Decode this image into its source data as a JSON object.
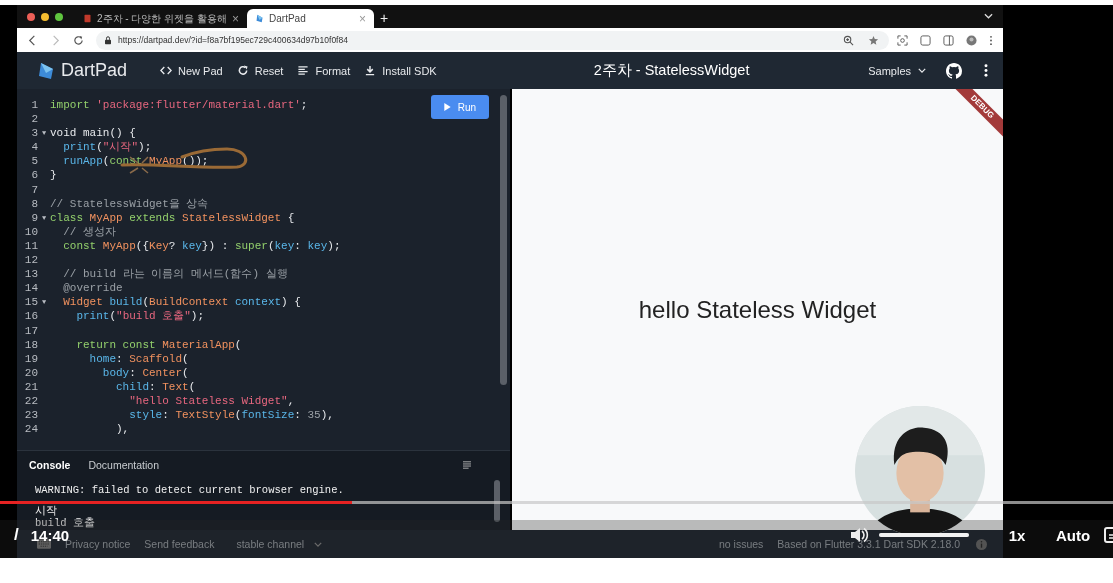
{
  "browser": {
    "tabs": [
      {
        "title": "2주차 - 다양한 위젯을 활용해",
        "selected": false,
        "close": "×"
      },
      {
        "title": "DartPad",
        "selected": true,
        "close": "×"
      }
    ],
    "new_tab": "+",
    "url": "https://dartpad.dev/?id=f8a7bf195ec729c400634d97b10f0f84"
  },
  "dartpad": {
    "brand": "DartPad",
    "actions": [
      "New Pad",
      "Reset",
      "Format",
      "Install SDK"
    ],
    "title": "2주차 - StatelessWidget",
    "samples": "Samples"
  },
  "editor": {
    "run": "Run",
    "lines": [
      {
        "n": "1",
        "tokens": [
          {
            "kind": "kw",
            "text": "import "
          },
          {
            "kind": "str",
            "text": "'package:flutter/material.dart'"
          },
          {
            "kind": "p",
            "text": ";"
          }
        ]
      },
      {
        "n": "2"
      },
      {
        "n": "3",
        "fold": "▼",
        "tokens": [
          {
            "kind": "p",
            "text": "void main() {"
          }
        ]
      },
      {
        "n": "4",
        "tokens": [
          {
            "kind": "fn",
            "text": "  print"
          },
          {
            "kind": "p",
            "text": "("
          },
          {
            "kind": "str",
            "text": "\"시작\""
          },
          {
            "kind": "p",
            "text": ");"
          }
        ]
      },
      {
        "n": "5",
        "tokens": [
          {
            "kind": "fn",
            "text": "  runApp"
          },
          {
            "kind": "p",
            "text": "("
          },
          {
            "kind": "kw",
            "text": "const "
          },
          {
            "kind": "type",
            "text": "MyApp"
          },
          {
            "kind": "p",
            "text": "());"
          }
        ]
      },
      {
        "n": "6",
        "tokens": [
          {
            "kind": "p",
            "text": "}"
          }
        ]
      },
      {
        "n": "7"
      },
      {
        "n": "8",
        "tokens": [
          {
            "kind": "com",
            "text": "// StatelessWidget을 상속"
          }
        ]
      },
      {
        "n": "9",
        "fold": "▼",
        "tokens": [
          {
            "kind": "kw",
            "text": "class "
          },
          {
            "kind": "type",
            "text": "MyApp "
          },
          {
            "kind": "kw",
            "text": "extends "
          },
          {
            "kind": "type",
            "text": "StatelessWidget "
          },
          {
            "kind": "p",
            "text": "{"
          }
        ]
      },
      {
        "n": "10",
        "tokens": [
          {
            "kind": "com",
            "text": "  // 생성자"
          }
        ]
      },
      {
        "n": "11",
        "tokens": [
          {
            "kind": "kw",
            "text": "  const "
          },
          {
            "kind": "type",
            "text": "MyApp"
          },
          {
            "kind": "p",
            "text": "({"
          },
          {
            "kind": "type",
            "text": "Key"
          },
          {
            "kind": "p",
            "text": "? "
          },
          {
            "kind": "fn",
            "text": "key"
          },
          {
            "kind": "p",
            "text": "}) : "
          },
          {
            "kind": "kw",
            "text": "super"
          },
          {
            "kind": "p",
            "text": "("
          },
          {
            "kind": "fn",
            "text": "key"
          },
          {
            "kind": "p",
            "text": ": "
          },
          {
            "kind": "fn",
            "text": "key"
          },
          {
            "kind": "p",
            "text": ");"
          }
        ]
      },
      {
        "n": "12"
      },
      {
        "n": "13",
        "tokens": [
          {
            "kind": "com",
            "text": "  // build 라는 이름의 메서드(함수) 실행"
          }
        ]
      },
      {
        "n": "14",
        "tokens": [
          {
            "kind": "com",
            "text": "  @override"
          }
        ]
      },
      {
        "n": "15",
        "fold": "▼",
        "tokens": [
          {
            "kind": "type",
            "text": "  Widget "
          },
          {
            "kind": "fn",
            "text": "build"
          },
          {
            "kind": "p",
            "text": "("
          },
          {
            "kind": "type",
            "text": "BuildContext "
          },
          {
            "kind": "fn",
            "text": "context"
          },
          {
            "kind": "p",
            "text": ") {"
          }
        ]
      },
      {
        "n": "16",
        "tokens": [
          {
            "kind": "fn",
            "text": "    print"
          },
          {
            "kind": "p",
            "text": "("
          },
          {
            "kind": "str",
            "text": "\"build 호출\""
          },
          {
            "kind": "p",
            "text": ");"
          }
        ]
      },
      {
        "n": "17"
      },
      {
        "n": "18",
        "tokens": [
          {
            "kind": "kw",
            "text": "    return const "
          },
          {
            "kind": "type",
            "text": "MaterialApp"
          },
          {
            "kind": "p",
            "text": "("
          }
        ]
      },
      {
        "n": "19",
        "tokens": [
          {
            "kind": "fn",
            "text": "      home"
          },
          {
            "kind": "p",
            "text": ": "
          },
          {
            "kind": "type",
            "text": "Scaffold"
          },
          {
            "kind": "p",
            "text": "("
          }
        ]
      },
      {
        "n": "20",
        "tokens": [
          {
            "kind": "fn",
            "text": "        body"
          },
          {
            "kind": "p",
            "text": ": "
          },
          {
            "kind": "type",
            "text": "Center"
          },
          {
            "kind": "p",
            "text": "("
          }
        ]
      },
      {
        "n": "21",
        "tokens": [
          {
            "kind": "fn",
            "text": "          child"
          },
          {
            "kind": "p",
            "text": ": "
          },
          {
            "kind": "type",
            "text": "Text"
          },
          {
            "kind": "p",
            "text": "("
          }
        ]
      },
      {
        "n": "22",
        "tokens": [
          {
            "kind": "str",
            "text": "            \"hello Stateless Widget\""
          },
          {
            "kind": "p",
            "text": ","
          }
        ]
      },
      {
        "n": "23",
        "tokens": [
          {
            "kind": "fn",
            "text": "            style"
          },
          {
            "kind": "p",
            "text": ": "
          },
          {
            "kind": "type",
            "text": "TextStyle"
          },
          {
            "kind": "p",
            "text": "("
          },
          {
            "kind": "fn",
            "text": "fontSize"
          },
          {
            "kind": "p",
            "text": ": "
          },
          {
            "kind": "com",
            "text": "35"
          },
          {
            "kind": "p",
            "text": "),"
          }
        ]
      },
      {
        "n": "24",
        "tokens": [
          {
            "kind": "p",
            "text": "          ),"
          }
        ]
      }
    ]
  },
  "console": {
    "tabs": [
      {
        "label": "Console",
        "selected": true
      },
      {
        "label": "Documentation",
        "selected": false
      }
    ],
    "lines": [
      "WARNING: failed to detect current browser engine.",
      "시작",
      "build 호출"
    ]
  },
  "output": {
    "text": "hello Stateless Widget",
    "banner": "DEBUG"
  },
  "footer": {
    "links": [
      "Privacy notice",
      "Send feedback"
    ],
    "channel": "stable channel",
    "status": "no issues",
    "version": "Based on Flutter 3.3.1 Dart SDK 2.18.0"
  },
  "video": {
    "progress": {
      "level": 0.316
    },
    "separator": "/",
    "duration": "14:40",
    "volume": {
      "level": 1
    },
    "speed": "1x",
    "quality": "Auto"
  }
}
